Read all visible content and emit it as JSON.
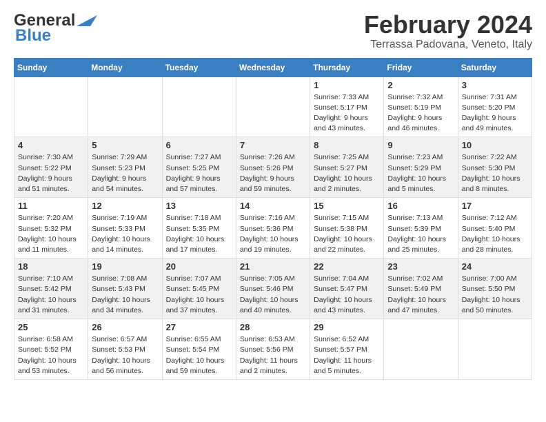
{
  "header": {
    "logo": {
      "line1": "General",
      "line2": "Blue"
    },
    "title": "February 2024",
    "location": "Terrassa Padovana, Veneto, Italy"
  },
  "calendar": {
    "days_of_week": [
      "Sunday",
      "Monday",
      "Tuesday",
      "Wednesday",
      "Thursday",
      "Friday",
      "Saturday"
    ],
    "weeks": [
      [
        {
          "day": "",
          "info": ""
        },
        {
          "day": "",
          "info": ""
        },
        {
          "day": "",
          "info": ""
        },
        {
          "day": "",
          "info": ""
        },
        {
          "day": "1",
          "info": "Sunrise: 7:33 AM\nSunset: 5:17 PM\nDaylight: 9 hours\nand 43 minutes."
        },
        {
          "day": "2",
          "info": "Sunrise: 7:32 AM\nSunset: 5:19 PM\nDaylight: 9 hours\nand 46 minutes."
        },
        {
          "day": "3",
          "info": "Sunrise: 7:31 AM\nSunset: 5:20 PM\nDaylight: 9 hours\nand 49 minutes."
        }
      ],
      [
        {
          "day": "4",
          "info": "Sunrise: 7:30 AM\nSunset: 5:22 PM\nDaylight: 9 hours\nand 51 minutes."
        },
        {
          "day": "5",
          "info": "Sunrise: 7:29 AM\nSunset: 5:23 PM\nDaylight: 9 hours\nand 54 minutes."
        },
        {
          "day": "6",
          "info": "Sunrise: 7:27 AM\nSunset: 5:25 PM\nDaylight: 9 hours\nand 57 minutes."
        },
        {
          "day": "7",
          "info": "Sunrise: 7:26 AM\nSunset: 5:26 PM\nDaylight: 9 hours\nand 59 minutes."
        },
        {
          "day": "8",
          "info": "Sunrise: 7:25 AM\nSunset: 5:27 PM\nDaylight: 10 hours\nand 2 minutes."
        },
        {
          "day": "9",
          "info": "Sunrise: 7:23 AM\nSunset: 5:29 PM\nDaylight: 10 hours\nand 5 minutes."
        },
        {
          "day": "10",
          "info": "Sunrise: 7:22 AM\nSunset: 5:30 PM\nDaylight: 10 hours\nand 8 minutes."
        }
      ],
      [
        {
          "day": "11",
          "info": "Sunrise: 7:20 AM\nSunset: 5:32 PM\nDaylight: 10 hours\nand 11 minutes."
        },
        {
          "day": "12",
          "info": "Sunrise: 7:19 AM\nSunset: 5:33 PM\nDaylight: 10 hours\nand 14 minutes."
        },
        {
          "day": "13",
          "info": "Sunrise: 7:18 AM\nSunset: 5:35 PM\nDaylight: 10 hours\nand 17 minutes."
        },
        {
          "day": "14",
          "info": "Sunrise: 7:16 AM\nSunset: 5:36 PM\nDaylight: 10 hours\nand 19 minutes."
        },
        {
          "day": "15",
          "info": "Sunrise: 7:15 AM\nSunset: 5:38 PM\nDaylight: 10 hours\nand 22 minutes."
        },
        {
          "day": "16",
          "info": "Sunrise: 7:13 AM\nSunset: 5:39 PM\nDaylight: 10 hours\nand 25 minutes."
        },
        {
          "day": "17",
          "info": "Sunrise: 7:12 AM\nSunset: 5:40 PM\nDaylight: 10 hours\nand 28 minutes."
        }
      ],
      [
        {
          "day": "18",
          "info": "Sunrise: 7:10 AM\nSunset: 5:42 PM\nDaylight: 10 hours\nand 31 minutes."
        },
        {
          "day": "19",
          "info": "Sunrise: 7:08 AM\nSunset: 5:43 PM\nDaylight: 10 hours\nand 34 minutes."
        },
        {
          "day": "20",
          "info": "Sunrise: 7:07 AM\nSunset: 5:45 PM\nDaylight: 10 hours\nand 37 minutes."
        },
        {
          "day": "21",
          "info": "Sunrise: 7:05 AM\nSunset: 5:46 PM\nDaylight: 10 hours\nand 40 minutes."
        },
        {
          "day": "22",
          "info": "Sunrise: 7:04 AM\nSunset: 5:47 PM\nDaylight: 10 hours\nand 43 minutes."
        },
        {
          "day": "23",
          "info": "Sunrise: 7:02 AM\nSunset: 5:49 PM\nDaylight: 10 hours\nand 47 minutes."
        },
        {
          "day": "24",
          "info": "Sunrise: 7:00 AM\nSunset: 5:50 PM\nDaylight: 10 hours\nand 50 minutes."
        }
      ],
      [
        {
          "day": "25",
          "info": "Sunrise: 6:58 AM\nSunset: 5:52 PM\nDaylight: 10 hours\nand 53 minutes."
        },
        {
          "day": "26",
          "info": "Sunrise: 6:57 AM\nSunset: 5:53 PM\nDaylight: 10 hours\nand 56 minutes."
        },
        {
          "day": "27",
          "info": "Sunrise: 6:55 AM\nSunset: 5:54 PM\nDaylight: 10 hours\nand 59 minutes."
        },
        {
          "day": "28",
          "info": "Sunrise: 6:53 AM\nSunset: 5:56 PM\nDaylight: 11 hours\nand 2 minutes."
        },
        {
          "day": "29",
          "info": "Sunrise: 6:52 AM\nSunset: 5:57 PM\nDaylight: 11 hours\nand 5 minutes."
        },
        {
          "day": "",
          "info": ""
        },
        {
          "day": "",
          "info": ""
        }
      ]
    ]
  }
}
